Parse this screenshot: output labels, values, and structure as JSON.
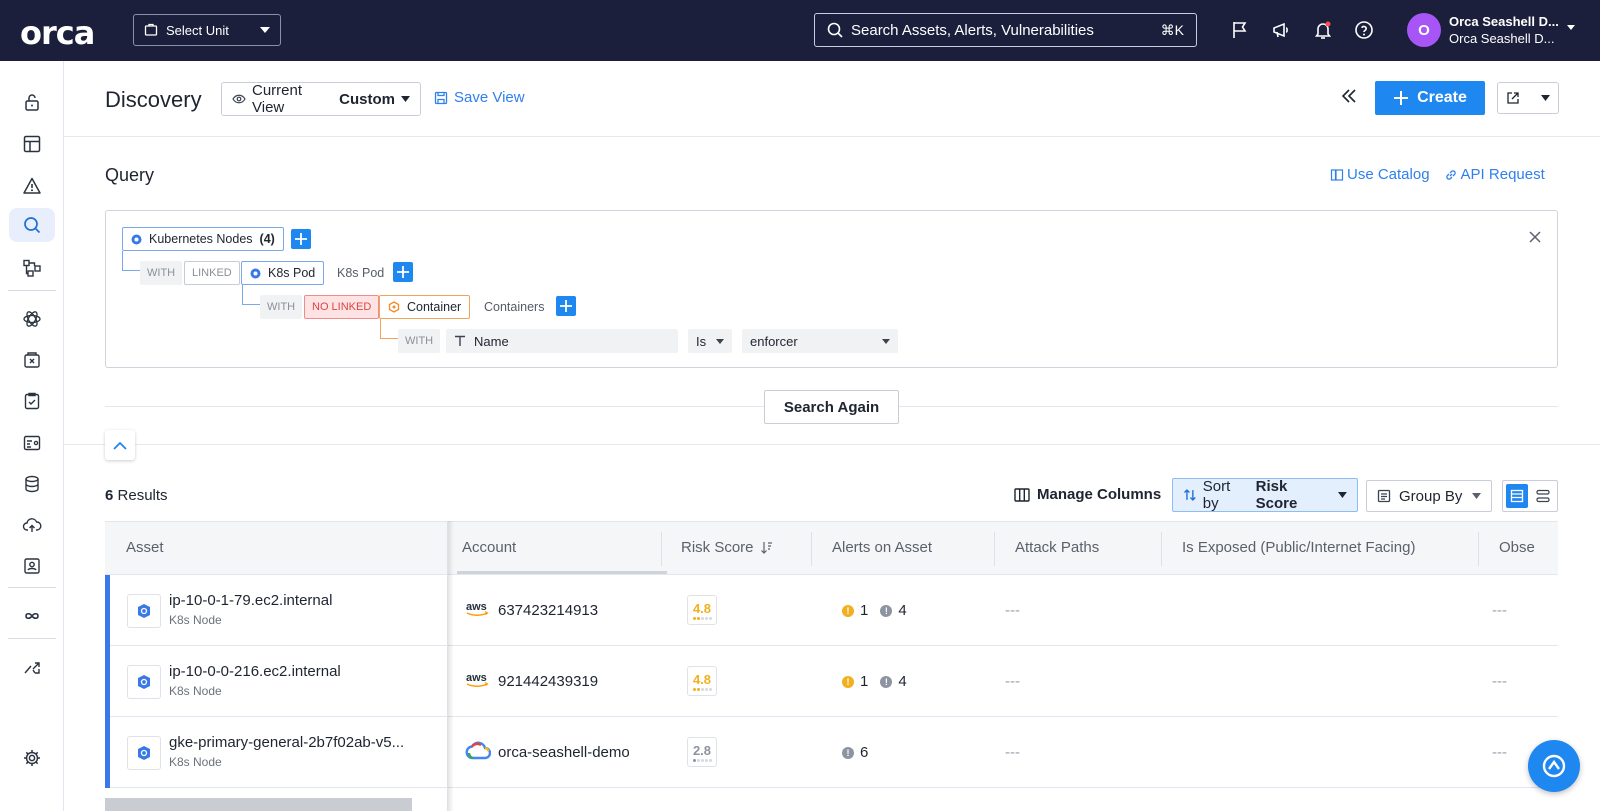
{
  "brand": {
    "logo": "orca"
  },
  "topbar": {
    "unit_select": "Select Unit",
    "search_placeholder": "Search Assets, Alerts, Vulnerabilities",
    "search_shortcut": "⌘K",
    "user_name": "Orca Seashell D...",
    "user_org": "Orca Seashell D...",
    "avatar_initial": "O",
    "avatar_color": "#a855f7"
  },
  "header": {
    "title": "Discovery",
    "view_prefix": "Current View",
    "view_value": "Custom",
    "save_view": "Save View",
    "create": "Create"
  },
  "query": {
    "title": "Query",
    "use_catalog": "Use Catalog",
    "api_request": "API Request",
    "root": {
      "label": "Kubernetes Nodes",
      "count": "(4)"
    },
    "level1": {
      "with": "WITH",
      "relation": "LINKED",
      "label": "K8s Pod",
      "plural": "K8s Pod"
    },
    "level2": {
      "with": "WITH",
      "relation": "NO LINKED",
      "label": "Container",
      "plural": "Containers"
    },
    "level3": {
      "with": "WITH",
      "field": "Name",
      "operator": "Is",
      "value": "enforcer"
    },
    "search_again": "Search Again"
  },
  "results": {
    "count": "6",
    "count_label": "Results",
    "manage_columns": "Manage Columns",
    "sort_prefix": "Sort by",
    "sort_value": "Risk Score",
    "group_by": "Group By"
  },
  "table": {
    "columns": [
      "Asset",
      "Account",
      "Risk Score",
      "Alerts on Asset",
      "Attack Paths",
      "Is Exposed (Public/Internet Facing)",
      "Obse"
    ],
    "rows": [
      {
        "asset": "ip-10-0-1-79.ec2.internal",
        "type": "K8s Node",
        "provider": "aws",
        "account": "637423214913",
        "risk": "4.8",
        "alert_yellow": "1",
        "alert_gray": "4",
        "attack_paths": "---",
        "observed": "---"
      },
      {
        "asset": "ip-10-0-0-216.ec2.internal",
        "type": "K8s Node",
        "provider": "aws",
        "account": "921442439319",
        "risk": "4.8",
        "alert_yellow": "1",
        "alert_gray": "4",
        "attack_paths": "---",
        "observed": "---"
      },
      {
        "asset": "gke-primary-general-2b7f02ab-v5...",
        "type": "K8s Node",
        "provider": "gcp",
        "account": "orca-seashell-demo",
        "risk": "2.8",
        "alert_gray": "6",
        "attack_paths": "---",
        "observed": "---"
      }
    ]
  },
  "colors": {
    "accent": "#1f87f0",
    "topbar": "#1b1f3b",
    "risk_high": "#f2b01e",
    "risk_low": "#8d93a0"
  }
}
